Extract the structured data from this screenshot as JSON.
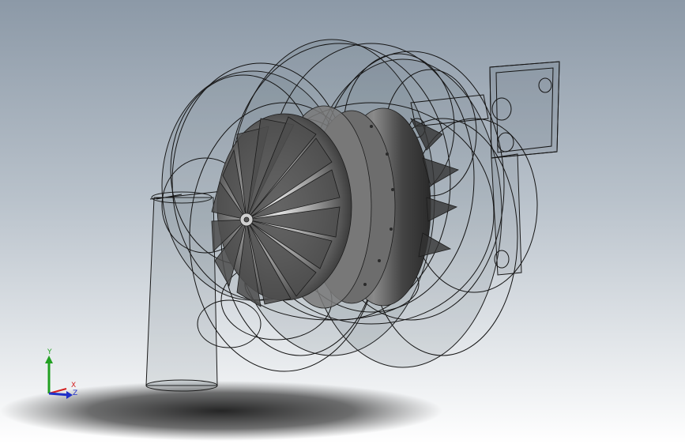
{
  "viewport": {
    "background_top": "#8d9aa8",
    "background_bottom": "#ffffff",
    "model": "turbocharger-assembly"
  },
  "triad": {
    "x_label": "X",
    "y_label": "Y",
    "z_label": "Z",
    "x_color": "#d42020",
    "y_color": "#22a022",
    "z_color": "#2030c8"
  }
}
